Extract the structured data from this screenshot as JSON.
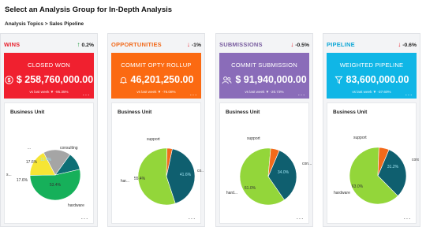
{
  "page": {
    "title": "Select an Analysis Group for In-Depth Analysis",
    "breadcrumb": [
      "Analysis Topics",
      ">",
      "Sales Pipeline"
    ]
  },
  "columns": [
    {
      "id": "wins",
      "name": "WINS",
      "name_color": "#e8222e",
      "delta": "0.2%",
      "delta_dir": "up",
      "delta_color": "#1a9b3b",
      "tile": {
        "title": "CLOSED WON",
        "value": "$ 258,760,000.00",
        "sub": "vs last week ▼ -95.35%",
        "bg": "#f0202f",
        "icon": "dollar-icon"
      },
      "card": {
        "title": "Business Unit",
        "chart_data": {
          "type": "pie",
          "categories": [
            "consulting",
            "hardware",
            "s...",
            "..."
          ],
          "values": [
            11.4,
            53.4,
            17.6,
            17.6
          ],
          "value_labels": [
            "11.4%",
            "53.4%",
            "17.6%",
            "17.6%"
          ],
          "colors": [
            "#0e6f75",
            "#16b05a",
            "#f6e535",
            "#a5a5a5"
          ]
        }
      }
    },
    {
      "id": "opportunities",
      "name": "OPPORTUNITIES",
      "name_color": "#f26a1b",
      "delta": "-1%",
      "delta_dir": "down",
      "delta_color": "#e8222e",
      "tile": {
        "title": "COMMIT OPTY ROLLUP",
        "value": "46,201,250.00",
        "sub": "vs last week ▼ -76.08%",
        "bg": "#fb6a12",
        "icon": "bell-icon"
      },
      "card": {
        "title": "Business Unit",
        "chart_data": {
          "type": "pie",
          "categories": [
            "co...",
            "har...",
            "support"
          ],
          "values": [
            41.6,
            55.4,
            3.0
          ],
          "value_labels": [
            "41.6%",
            "55.4%",
            ""
          ],
          "colors": [
            "#0f5f6f",
            "#93d63a",
            "#f26a1b"
          ]
        }
      }
    },
    {
      "id": "submissions",
      "name": "SUBMISSIONS",
      "name_color": "#7a5ea0",
      "delta": "-0.5%",
      "delta_dir": "down",
      "delta_color": "#e8222e",
      "tile": {
        "title": "COMMIT SUBMISSION",
        "value": "$ 91,940,000.00",
        "sub": "vs last week ▼ -20.73%",
        "bg": "#8a6cb9",
        "icon": "users-icon"
      },
      "card": {
        "title": "Business Unit",
        "chart_data": {
          "type": "pie",
          "categories": [
            "con...",
            "hard...",
            "support"
          ],
          "values": [
            34.0,
            61.0,
            5.0
          ],
          "value_labels": [
            "34.0%",
            "61.0%",
            ""
          ],
          "colors": [
            "#0f5f6f",
            "#93d63a",
            "#f26a1b"
          ]
        }
      }
    },
    {
      "id": "pipeline",
      "name": "PIPELINE",
      "name_color": "#0fa7d6",
      "delta": "-0.6%",
      "delta_dir": "down",
      "delta_color": "#e8222e",
      "tile": {
        "title": "WEIGHTED PIPELINE",
        "value": "83,600,000.00",
        "sub": "vs last week ▼ -37.60%",
        "bg": "#10b6e6",
        "icon": "filter-icon"
      },
      "card": {
        "title": "Business Unit",
        "chart_data": {
          "type": "pie",
          "categories": [
            "cons...",
            "hardware",
            "support"
          ],
          "values": [
            31.2,
            63.0,
            5.8
          ],
          "value_labels": [
            "31.2%",
            "63.0%",
            ""
          ],
          "colors": [
            "#0f5f6f",
            "#93d63a",
            "#f26a1b"
          ]
        }
      }
    }
  ]
}
